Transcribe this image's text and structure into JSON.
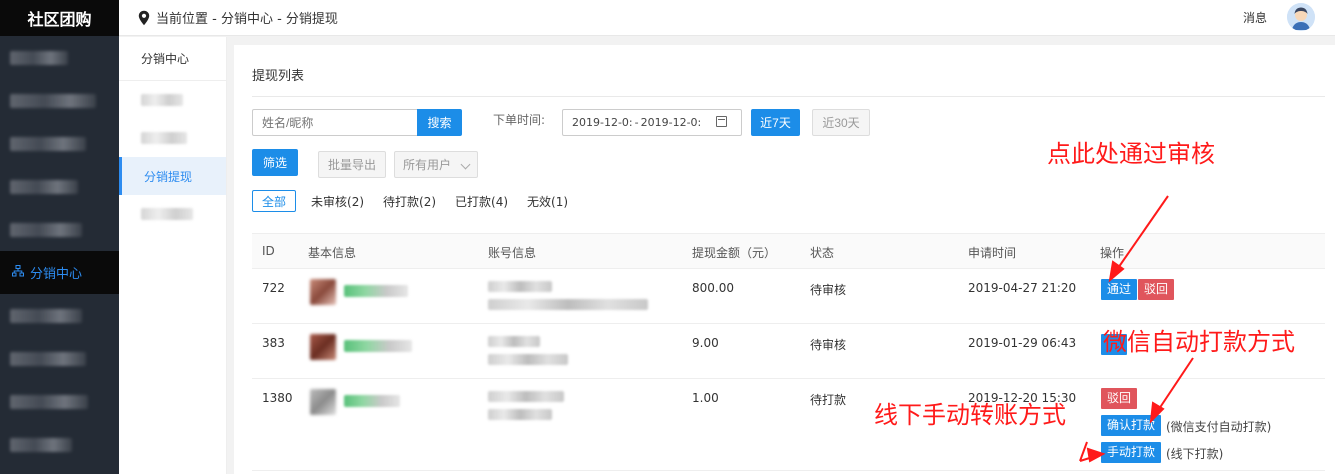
{
  "app": {
    "logo": "社区团购"
  },
  "nav": {
    "active_label": "分销中心",
    "active_icon": "sitemap-icon"
  },
  "header": {
    "breadcrumb": "当前位置 - 分销中心 - 分销提现",
    "messages": "消息"
  },
  "subnav": {
    "title": "分销中心",
    "active_label": "分销提现"
  },
  "panel": {
    "title": "提现列表"
  },
  "search": {
    "placeholder": "姓名/昵称",
    "button": "搜索"
  },
  "date": {
    "label": "下单时间:",
    "start": "2019-12-0:",
    "separator": "-",
    "end": "2019-12-0:"
  },
  "quick": {
    "last7": "近7天",
    "last30": "近30天"
  },
  "toolbar": {
    "filter": "筛选",
    "export": "批量导出",
    "user_select": "所有用户"
  },
  "tabs": [
    "全部",
    "未审核(2)",
    "待打款(2)",
    "已打款(4)",
    "无效(1)"
  ],
  "table": {
    "headers": [
      "ID",
      "基本信息",
      "账号信息",
      "提现金额（元）",
      "状态",
      "申请时间",
      "操作"
    ],
    "rows": [
      {
        "id": "722",
        "amount": "800.00",
        "status": "待审核",
        "time": "2019-04-27 21:20"
      },
      {
        "id": "383",
        "amount": "9.00",
        "status": "待审核",
        "time": "2019-01-29 06:43"
      },
      {
        "id": "1380",
        "amount": "1.00",
        "status": "待打款",
        "time": "2019-12-20 15:30"
      }
    ]
  },
  "actions": {
    "approve": "通过",
    "reject": "驳回",
    "confirm_pay": "确认打款",
    "confirm_pay_note": "(微信支付自动打款)",
    "manual_pay": "手动打款",
    "manual_pay_note": "(线下打款)"
  },
  "annotations": {
    "approve_hint": "点此处通过审核",
    "wechat_hint": "微信自动打款方式",
    "offline_hint": "线下手动转账方式",
    "color": "#ff1a1a"
  },
  "colors": {
    "primary": "#1c8de8",
    "danger": "#e0555c",
    "nav_bg": "#242b35"
  }
}
